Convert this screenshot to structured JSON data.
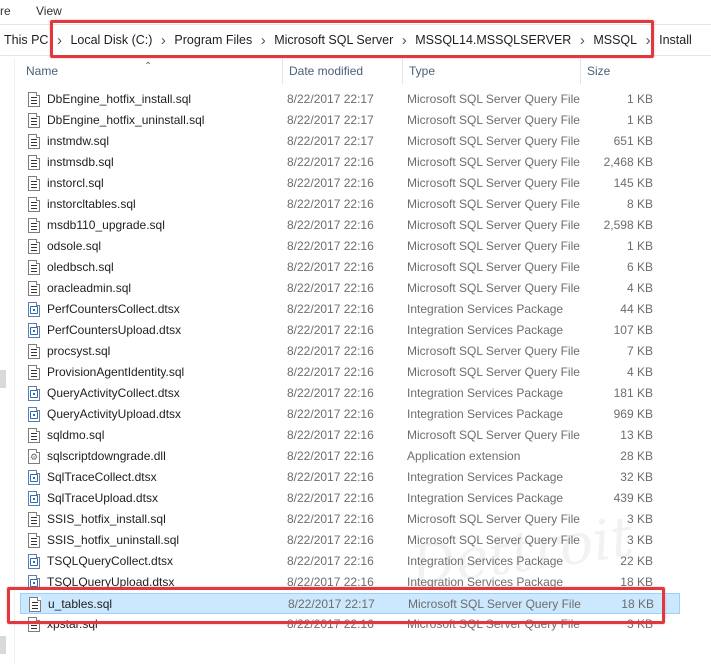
{
  "ribbon": {
    "share_tab": "re",
    "view_tab": "View"
  },
  "breadcrumb": [
    "This PC",
    "Local Disk (C:)",
    "Program Files",
    "Microsoft SQL Server",
    "MSSQL14.MSSQLSERVER",
    "MSSQL",
    "Install"
  ],
  "columns": {
    "name": "Name",
    "date": "Date modified",
    "type": "Type",
    "size": "Size"
  },
  "files": [
    {
      "name": "DbEngine_hotfix_install.sql",
      "date": "8/22/2017 22:17",
      "type": "Microsoft SQL Server Query File",
      "size": "1 KB",
      "icon": "sql-file-icon"
    },
    {
      "name": "DbEngine_hotfix_uninstall.sql",
      "date": "8/22/2017 22:17",
      "type": "Microsoft SQL Server Query File",
      "size": "1 KB",
      "icon": "sql-file-icon"
    },
    {
      "name": "instmdw.sql",
      "date": "8/22/2017 22:17",
      "type": "Microsoft SQL Server Query File",
      "size": "651 KB",
      "icon": "sql-file-icon"
    },
    {
      "name": "instmsdb.sql",
      "date": "8/22/2017 22:16",
      "type": "Microsoft SQL Server Query File",
      "size": "2,468 KB",
      "icon": "sql-file-icon"
    },
    {
      "name": "instorcl.sql",
      "date": "8/22/2017 22:16",
      "type": "Microsoft SQL Server Query File",
      "size": "145 KB",
      "icon": "sql-file-icon"
    },
    {
      "name": "instorcltables.sql",
      "date": "8/22/2017 22:16",
      "type": "Microsoft SQL Server Query File",
      "size": "8 KB",
      "icon": "sql-file-icon"
    },
    {
      "name": "msdb110_upgrade.sql",
      "date": "8/22/2017 22:16",
      "type": "Microsoft SQL Server Query File",
      "size": "2,598 KB",
      "icon": "sql-file-icon"
    },
    {
      "name": "odsole.sql",
      "date": "8/22/2017 22:16",
      "type": "Microsoft SQL Server Query File",
      "size": "1 KB",
      "icon": "sql-file-icon"
    },
    {
      "name": "oledbsch.sql",
      "date": "8/22/2017 22:16",
      "type": "Microsoft SQL Server Query File",
      "size": "6 KB",
      "icon": "sql-file-icon"
    },
    {
      "name": "oracleadmin.sql",
      "date": "8/22/2017 22:16",
      "type": "Microsoft SQL Server Query File",
      "size": "4 KB",
      "icon": "sql-file-icon"
    },
    {
      "name": "PerfCountersCollect.dtsx",
      "date": "8/22/2017 22:16",
      "type": "Integration Services Package",
      "size": "44 KB",
      "icon": "dtsx-file-icon"
    },
    {
      "name": "PerfCountersUpload.dtsx",
      "date": "8/22/2017 22:16",
      "type": "Integration Services Package",
      "size": "107 KB",
      "icon": "dtsx-file-icon"
    },
    {
      "name": "procsyst.sql",
      "date": "8/22/2017 22:16",
      "type": "Microsoft SQL Server Query File",
      "size": "7 KB",
      "icon": "sql-file-icon"
    },
    {
      "name": "ProvisionAgentIdentity.sql",
      "date": "8/22/2017 22:16",
      "type": "Microsoft SQL Server Query File",
      "size": "4 KB",
      "icon": "sql-file-icon"
    },
    {
      "name": "QueryActivityCollect.dtsx",
      "date": "8/22/2017 22:16",
      "type": "Integration Services Package",
      "size": "181 KB",
      "icon": "dtsx-file-icon"
    },
    {
      "name": "QueryActivityUpload.dtsx",
      "date": "8/22/2017 22:16",
      "type": "Integration Services Package",
      "size": "969 KB",
      "icon": "dtsx-file-icon"
    },
    {
      "name": "sqldmo.sql",
      "date": "8/22/2017 22:16",
      "type": "Microsoft SQL Server Query File",
      "size": "13 KB",
      "icon": "sql-file-icon"
    },
    {
      "name": "sqlscriptdowngrade.dll",
      "date": "8/22/2017 22:16",
      "type": "Application extension",
      "size": "28 KB",
      "icon": "dll-file-icon"
    },
    {
      "name": "SqlTraceCollect.dtsx",
      "date": "8/22/2017 22:16",
      "type": "Integration Services Package",
      "size": "32 KB",
      "icon": "dtsx-file-icon"
    },
    {
      "name": "SqlTraceUpload.dtsx",
      "date": "8/22/2017 22:16",
      "type": "Integration Services Package",
      "size": "439 KB",
      "icon": "dtsx-file-icon"
    },
    {
      "name": "SSIS_hotfix_install.sql",
      "date": "8/22/2017 22:16",
      "type": "Microsoft SQL Server Query File",
      "size": "3 KB",
      "icon": "sql-file-icon"
    },
    {
      "name": "SSIS_hotfix_uninstall.sql",
      "date": "8/22/2017 22:16",
      "type": "Microsoft SQL Server Query File",
      "size": "3 KB",
      "icon": "sql-file-icon"
    },
    {
      "name": "TSQLQueryCollect.dtsx",
      "date": "8/22/2017 22:16",
      "type": "Integration Services Package",
      "size": "22 KB",
      "icon": "dtsx-file-icon"
    },
    {
      "name": "TSQLQueryUpload.dtsx",
      "date": "8/22/2017 22:16",
      "type": "Integration Services Package",
      "size": "18 KB",
      "icon": "dtsx-file-icon"
    },
    {
      "name": "u_tables.sql",
      "date": "8/22/2017 22:17",
      "type": "Microsoft SQL Server Query File",
      "size": "18 KB",
      "icon": "sql-file-icon",
      "selected": true
    },
    {
      "name": "xpstar.sql",
      "date": "8/22/2017 22:16",
      "type": "Microsoft SQL Server Query File",
      "size": "3 KB",
      "icon": "sql-file-icon"
    }
  ],
  "colors": {
    "highlight": "#e0383e",
    "selection": "#cce8ff",
    "header_text": "#4c607a"
  }
}
